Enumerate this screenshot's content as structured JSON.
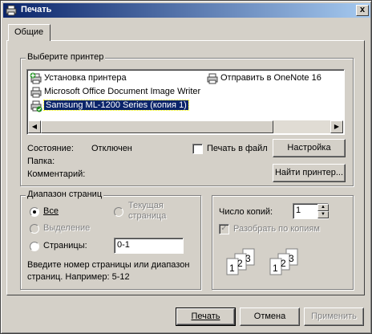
{
  "window": {
    "title": "Печать",
    "close_label": "x"
  },
  "tabs": [
    {
      "label": "Общие"
    }
  ],
  "select_printer": {
    "group_title": "Выберите принтер",
    "printers": [
      {
        "name": "Установка принтера",
        "icon": "add-printer-icon"
      },
      {
        "name": "Отправить в OneNote 16",
        "icon": "printer-icon"
      },
      {
        "name": "Microsoft Office Document Image Writer",
        "icon": "printer-icon"
      },
      {
        "name": "Samsung ML-1200 Series (копия 1)",
        "icon": "default-printer-icon",
        "selected": true
      }
    ],
    "status_label": "Состояние:",
    "status_value": "Отключен",
    "location_label": "Папка:",
    "comment_label": "Комментарий:",
    "print_to_file_label": "Печать в файл",
    "print_to_file_checked": false,
    "preferences_button": "Настройка",
    "find_printer_button": "Найти принтер..."
  },
  "page_range": {
    "group_title": "Диапазон страниц",
    "all_label": "Все",
    "selection_label": "Выделение",
    "current_page_label_1": "Текущая",
    "current_page_label_2": "страница",
    "pages_label": "Страницы:",
    "pages_value": "0-1",
    "hint_line1": "Введите номер страницы или диапазон",
    "hint_line2": "страниц.  Например: 5-12",
    "selected_option": "all"
  },
  "copies": {
    "count_label": "Число копий:",
    "count_value": "1",
    "collate_label": "Разобрать по копиям",
    "collate_checked": true,
    "collate_icon": "collate-pages-icon",
    "page_numbers": [
      "1",
      "2",
      "3",
      "1",
      "2",
      "3"
    ]
  },
  "footer": {
    "print_button": "Печать",
    "cancel_button": "Отмена",
    "apply_button": "Применить"
  }
}
